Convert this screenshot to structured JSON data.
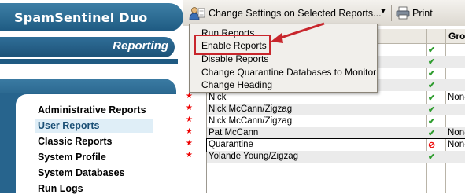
{
  "sidebar": {
    "brand": "SpamSentinel Duo",
    "section": "Reporting",
    "nav": [
      {
        "label": "Administrative Reports"
      },
      {
        "label": "User Reports",
        "selected": true
      },
      {
        "label": "Classic Reports"
      },
      {
        "label": "System Profile"
      },
      {
        "label": "System Databases"
      },
      {
        "label": "Run Logs"
      }
    ]
  },
  "toolbar": {
    "change_label": "Change Settings on Selected Reports...",
    "print_label": "Print"
  },
  "grid": {
    "group_header": "Gro",
    "rows": [
      {
        "name": "Nick",
        "status": "ok",
        "group": "Non-",
        "star": true
      },
      {
        "name": "Nick McCann/Zigzag",
        "status": "ok",
        "group": "",
        "star": true
      },
      {
        "name": "Nick McCann/Zigzag",
        "status": "ok",
        "group": "",
        "star": true
      },
      {
        "name": "Pat McCann",
        "status": "ok",
        "group": "Non-",
        "star": true
      },
      {
        "name": "Quarantine",
        "status": "blocked",
        "group": "Non-",
        "star": true,
        "selected": true
      },
      {
        "name": "Yolande Young/Zigzag",
        "status": "ok",
        "group": "",
        "star": true
      }
    ]
  },
  "menu": {
    "items": [
      {
        "label": "Run Reports"
      },
      {
        "label": "Enable Reports",
        "highlighted": true
      },
      {
        "label": "Disable Reports"
      },
      {
        "label": "Change Quarantine Databases to Monitor"
      },
      {
        "label": "Change Heading"
      }
    ]
  },
  "colors": {
    "accent": "#27648d",
    "annotation": "#c8262c",
    "ok": "#2e9c2e",
    "blocked": "#e11111"
  }
}
